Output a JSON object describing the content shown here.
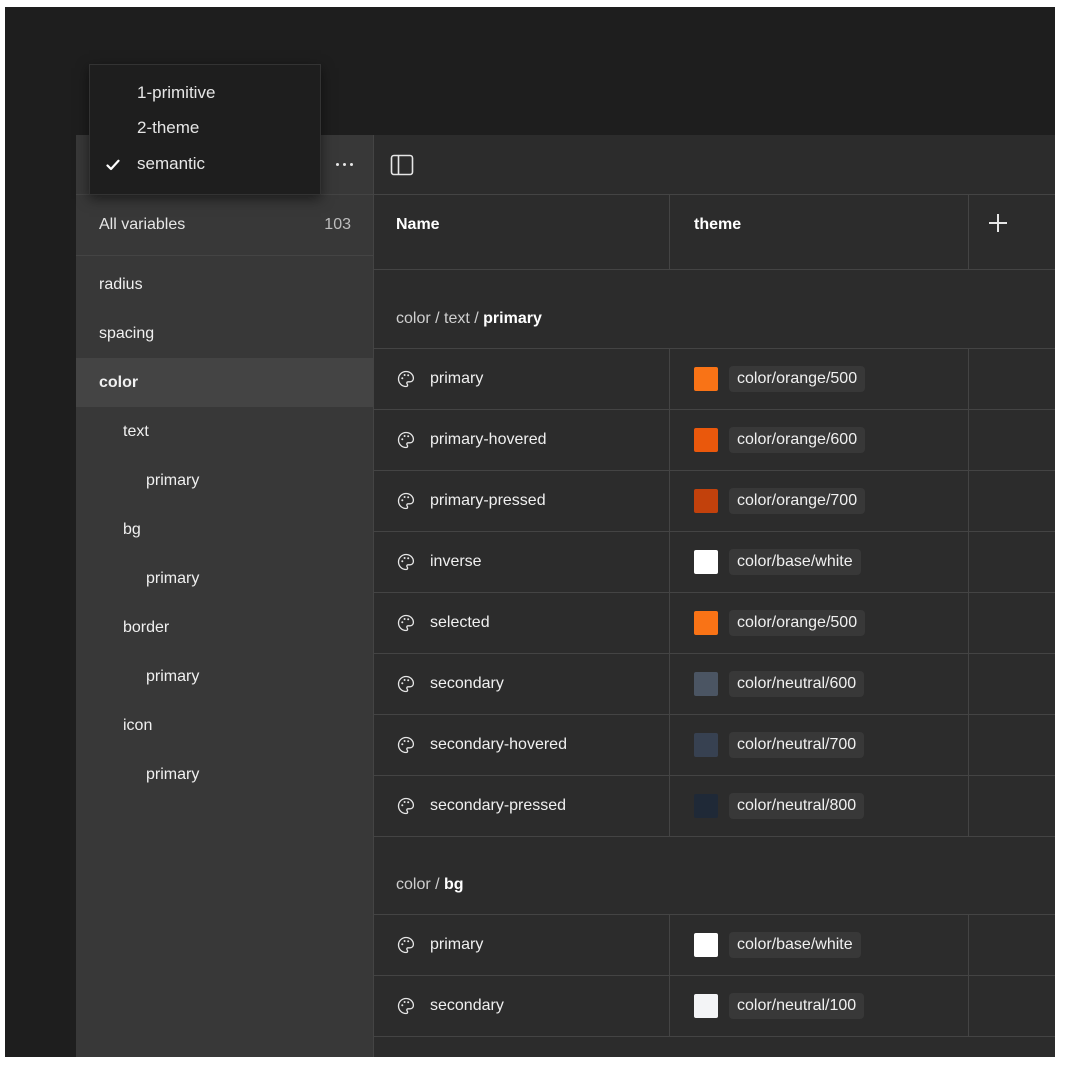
{
  "modes_menu": {
    "items": [
      {
        "label": "1-primitive",
        "checked": false
      },
      {
        "label": "2-theme",
        "checked": false
      },
      {
        "label": "semantic",
        "checked": true
      }
    ]
  },
  "sidebar": {
    "more_icon": "ellipsis-icon",
    "all_variables": {
      "label": "All variables",
      "count": "103"
    },
    "groups": [
      {
        "label": "radius",
        "level": 0
      },
      {
        "label": "spacing",
        "level": 0
      },
      {
        "label": "color",
        "level": 0,
        "active": true
      },
      {
        "label": "text",
        "level": 1
      },
      {
        "label": "primary",
        "level": 2
      },
      {
        "label": "bg",
        "level": 1
      },
      {
        "label": "primary",
        "level": 2
      },
      {
        "label": "border",
        "level": 1
      },
      {
        "label": "primary",
        "level": 2
      },
      {
        "label": "icon",
        "level": 1
      },
      {
        "label": "primary",
        "level": 2
      }
    ]
  },
  "toolbar": {
    "panel_icon": "sidebar-panel-icon"
  },
  "table": {
    "columns": {
      "name": "Name",
      "mode": "theme",
      "add_icon": "plus-icon"
    },
    "sections": [
      {
        "path_prefix": "color / text / ",
        "path_last": "primary",
        "rows": [
          {
            "name": "primary",
            "value": "color/orange/500",
            "swatch": "#f97316"
          },
          {
            "name": "primary-hovered",
            "value": "color/orange/600",
            "swatch": "#ea580c"
          },
          {
            "name": "primary-pressed",
            "value": "color/orange/700",
            "swatch": "#c2410c"
          },
          {
            "name": "inverse",
            "value": "color/base/white",
            "swatch": "#ffffff"
          },
          {
            "name": "selected",
            "value": "color/orange/500",
            "swatch": "#f97316"
          },
          {
            "name": "secondary",
            "value": "color/neutral/600",
            "swatch": "#4b5563"
          },
          {
            "name": "secondary-hovered",
            "value": "color/neutral/700",
            "swatch": "#374151"
          },
          {
            "name": "secondary-pressed",
            "value": "color/neutral/800",
            "swatch": "#1f2937"
          }
        ]
      },
      {
        "path_prefix": "color / ",
        "path_last": "bg",
        "rows": [
          {
            "name": "primary",
            "value": "color/base/white",
            "swatch": "#ffffff"
          },
          {
            "name": "secondary",
            "value": "color/neutral/100",
            "swatch": "#f3f4f6"
          }
        ]
      }
    ]
  }
}
